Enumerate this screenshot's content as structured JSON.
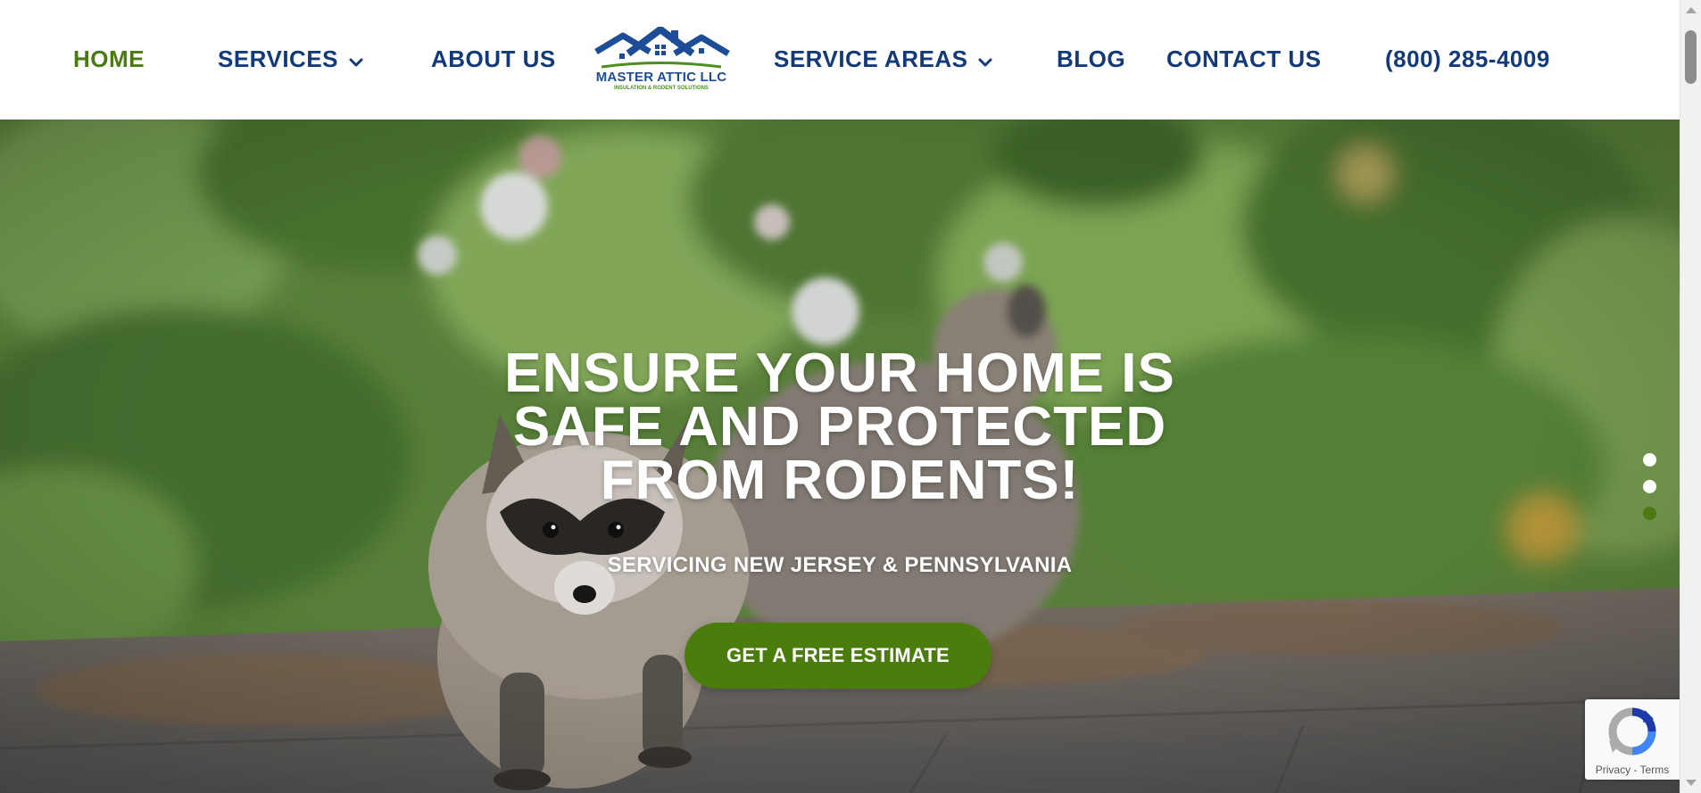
{
  "header": {
    "nav": {
      "home": "HOME",
      "services": "SERVICES",
      "about": "ABOUT US",
      "service_areas": "SERVICE AREAS",
      "blog": "BLOG",
      "contact": "CONTACT US",
      "phone": "(800) 285-4009"
    },
    "logo": {
      "name": "MASTER ATTIC LLC",
      "tagline": "INSULATION & RODENT SOLUTIONS"
    }
  },
  "hero": {
    "title_lines": [
      "ENSURE YOUR HOME IS",
      "SAFE AND PROTECTED",
      "FROM RODENTS!"
    ],
    "subtitle": "SERVICING NEW JERSEY & PENNSYLVANIA",
    "cta_label": "GET A FREE ESTIMATE",
    "slider": {
      "slide_count": 3,
      "active_slide": 3
    }
  },
  "recaptcha": {
    "terms": "Privacy - Terms"
  },
  "colors": {
    "nav_blue": "#123a7a",
    "active_green": "#4b7a12",
    "cta_green": "#4b7d0c",
    "foliage_green": "#6b8f4a",
    "roof_gray": "#6f6e6c"
  },
  "icons": {
    "dropdown": "chevron-down-icon",
    "logo_houses": "house-roof-icon",
    "recaptcha": "recaptcha-icon"
  }
}
